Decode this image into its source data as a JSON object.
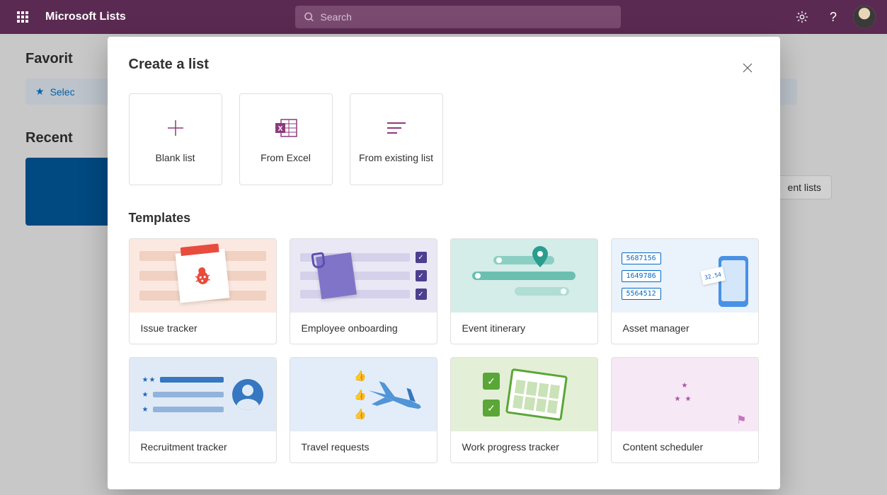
{
  "header": {
    "app_title": "Microsoft Lists",
    "search_placeholder": "Search"
  },
  "page": {
    "favorites_title": "Favorit",
    "select_text": "Selec",
    "recent_title": "Recent",
    "recent_lists_chip": "ent lists"
  },
  "dialog": {
    "title": "Create a list",
    "options": [
      {
        "label": "Blank list"
      },
      {
        "label": "From Excel"
      },
      {
        "label": "From existing list"
      }
    ],
    "templates_title": "Templates",
    "templates": [
      {
        "label": "Issue tracker"
      },
      {
        "label": "Employee onboarding"
      },
      {
        "label": "Event itinerary"
      },
      {
        "label": "Asset manager",
        "ids": [
          "5687156",
          "1649786",
          "5564512"
        ],
        "price": "32.54"
      },
      {
        "label": "Recruitment tracker"
      },
      {
        "label": "Travel requests"
      },
      {
        "label": "Work progress tracker"
      },
      {
        "label": "Content scheduler"
      }
    ]
  }
}
